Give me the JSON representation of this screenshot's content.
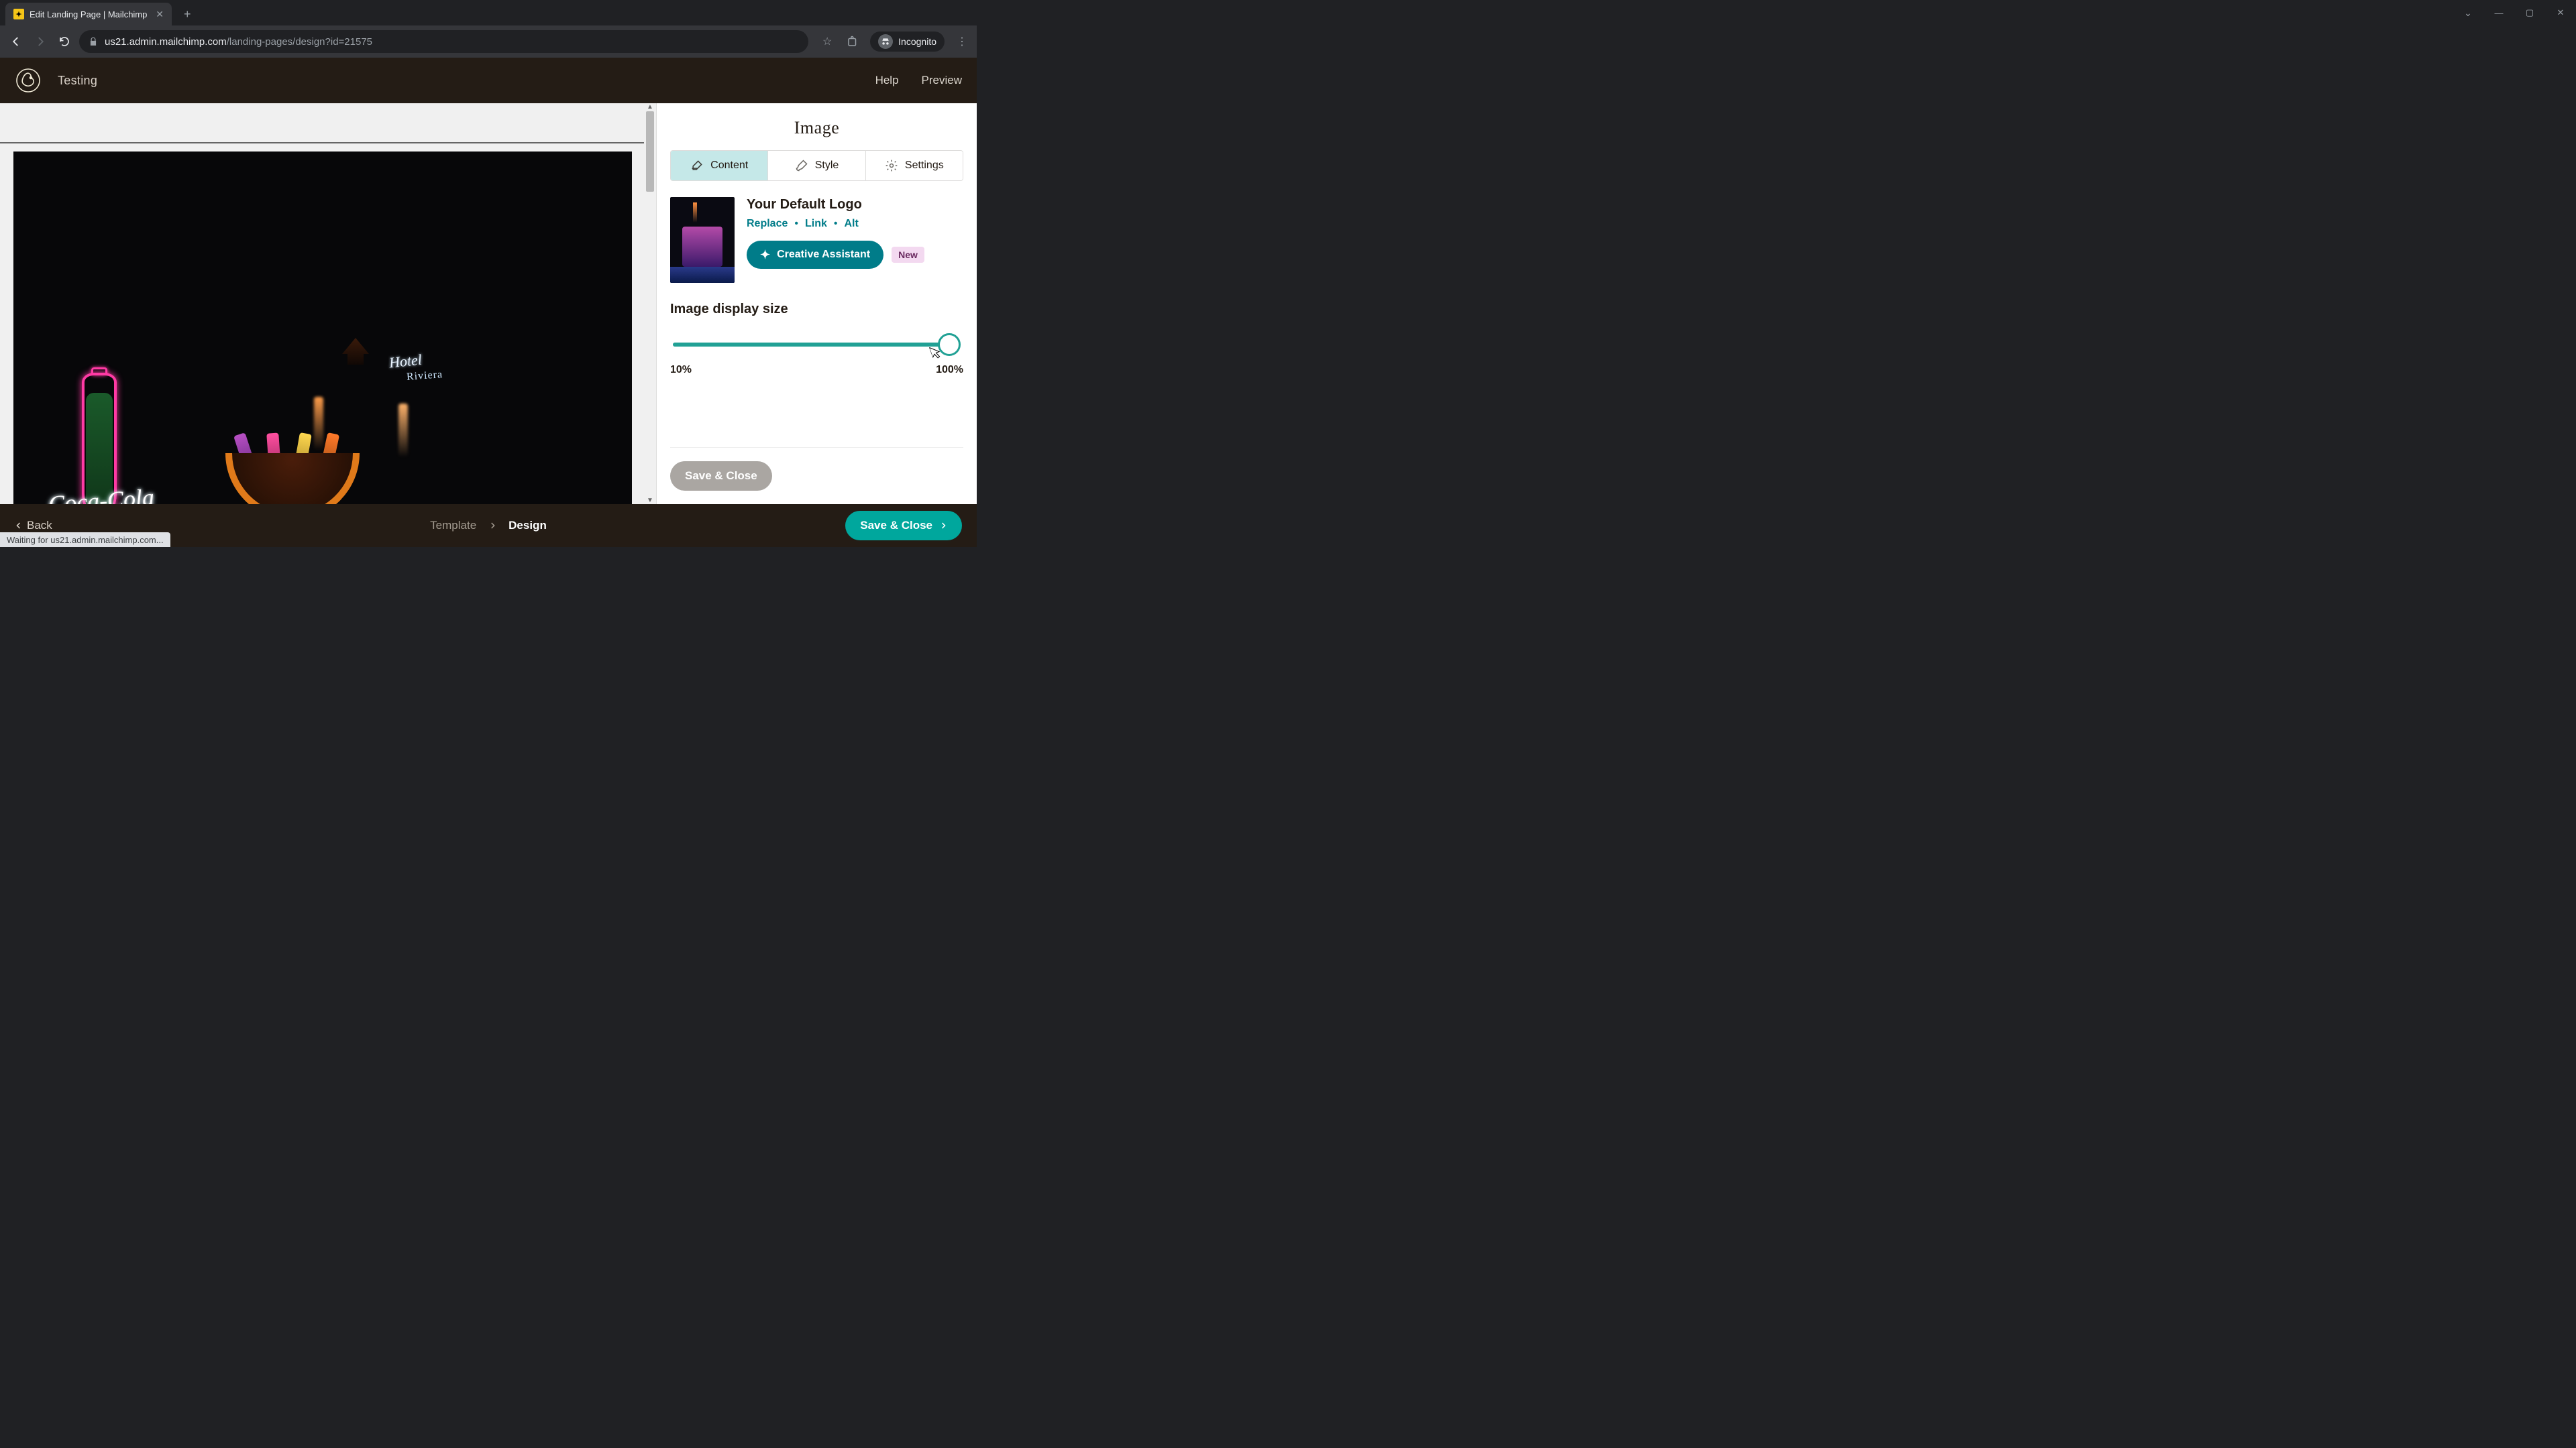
{
  "browser": {
    "tab_title": "Edit Landing Page | Mailchimp",
    "url_host": "us21.admin.mailchimp.com",
    "url_path": "/landing-pages/design?id=21575",
    "incognito_label": "Incognito",
    "status_text": "Waiting for us21.admin.mailchimp.com..."
  },
  "header": {
    "doc_title": "Testing",
    "help": "Help",
    "preview": "Preview"
  },
  "canvas": {
    "neon_hotel": "Hotel",
    "neon_hotel_sub": "Riviera",
    "cola_text": "Coca-Cola"
  },
  "sidebar": {
    "panel_title": "Image",
    "tabs": {
      "content": "Content",
      "style": "Style",
      "settings": "Settings"
    },
    "image_name": "Your Default Logo",
    "actions": {
      "replace": "Replace",
      "link": "Link",
      "alt": "Alt"
    },
    "creative_assistant": "Creative Assistant",
    "new_badge": "New",
    "slider": {
      "title": "Image display size",
      "min_label": "10%",
      "max_label": "100%"
    },
    "save_close": "Save & Close"
  },
  "footer": {
    "back": "Back",
    "crumb_template": "Template",
    "crumb_design": "Design",
    "save_close": "Save & Close"
  }
}
